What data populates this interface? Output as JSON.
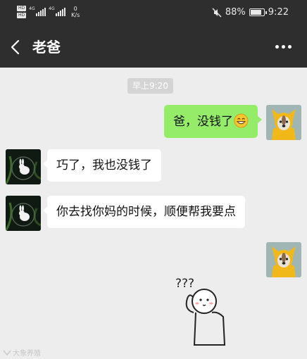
{
  "status_bar": {
    "hd_top": "HD",
    "hd_bottom": "HD",
    "net1": "4G",
    "net2": "4G",
    "speed_value": "0",
    "speed_unit": "K/s",
    "battery_percent": "88%",
    "battery_level": 0.88,
    "time": "9:22",
    "icons": [
      "mute-icon",
      "battery-icon",
      "signal-icon"
    ]
  },
  "header": {
    "title": "老爸",
    "back_icon": "chevron-left-icon",
    "more_icon": "more-dots-icon"
  },
  "chat": {
    "timestamp": "早上9:20",
    "messages": [
      {
        "sender": "me",
        "text": "爸，没钱了",
        "emoji": "grinning-face"
      },
      {
        "sender": "them",
        "text": "巧了，我也没钱了"
      },
      {
        "sender": "them",
        "text": "你去找你妈的时候，顺便帮我要点"
      },
      {
        "sender": "me",
        "type": "sticker",
        "sticker_text": "???"
      }
    ]
  },
  "watermark": "大象养殖",
  "colors": {
    "header_bg": "#2e2e2e",
    "chat_bg": "#ededed",
    "my_bubble": "#95ec69",
    "their_bubble": "#ffffff"
  }
}
